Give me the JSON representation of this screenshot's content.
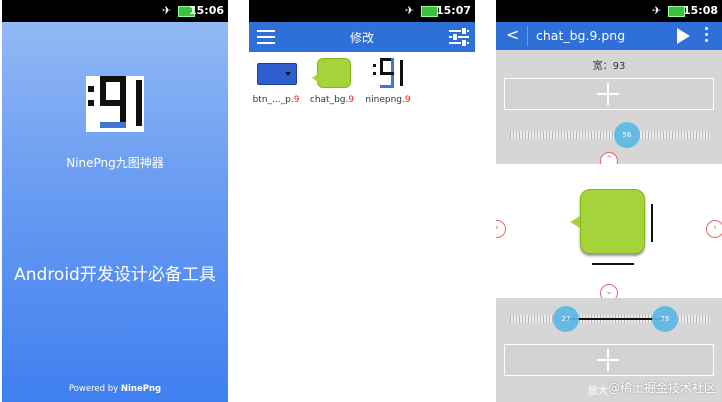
{
  "status_bars": [
    {
      "time": "15:06"
    },
    {
      "time": "15:07"
    },
    {
      "time": "15:08"
    }
  ],
  "splash": {
    "app_name": "NinePng九图神器",
    "slogan": "Android开发设计必备工具",
    "powered_prefix": "Powered by ",
    "powered_brand": "NinePng",
    "gradient_top": "#98bdf5",
    "gradient_bottom": "#3f7ff0"
  },
  "edit_list": {
    "title": "修改",
    "files": [
      {
        "name": "btn_..._p.",
        "suffix": "9"
      },
      {
        "name": "chat_bg.",
        "suffix": "9"
      },
      {
        "name": "ninepng.",
        "suffix": "9"
      }
    ]
  },
  "editor": {
    "file_title": "chat_bg.9.png",
    "width_label": "宽：93",
    "top_slider_value": "56",
    "bottom_slider_left": "27",
    "bottom_slider_right": "76",
    "bottom_hidden_label": "放大",
    "watermark": "@稀土掘金技术社区"
  },
  "colors": {
    "accent_blue": "#2f6fd8",
    "bubble_green": "#a5d43a",
    "nine_red": "#e02020",
    "knob_blue": "#5bb8e6"
  }
}
